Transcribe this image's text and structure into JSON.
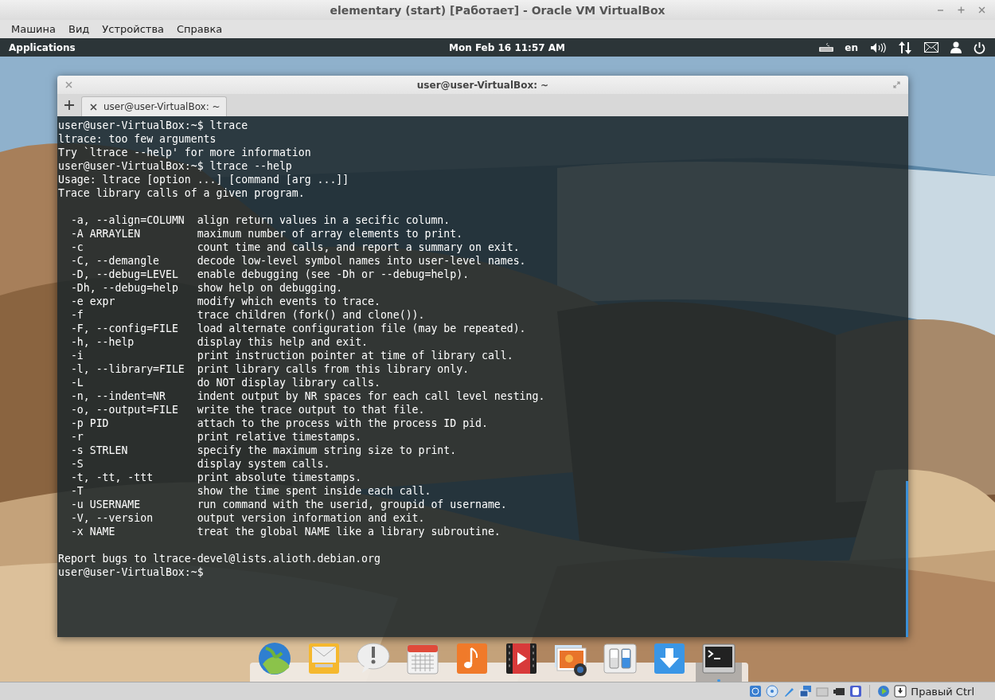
{
  "host_window": {
    "title": "elementary (start) [Работает] - Oracle VM VirtualBox",
    "menu": [
      "Машина",
      "Вид",
      "Устройства",
      "Справка"
    ]
  },
  "panel": {
    "applications": "Applications",
    "clock": "Mon Feb 16 11:57 AM",
    "language": "en"
  },
  "terminal": {
    "title": "user@user-VirtualBox: ~",
    "tabs": [
      {
        "label": "user@user-VirtualBox: ~",
        "selected": true
      }
    ],
    "blocks": [
      [
        "user@user-VirtualBox:~$ ltrace",
        "ltrace: too few arguments",
        "Try `ltrace --help' for more information",
        "user@user-VirtualBox:~$ ltrace --help",
        "Usage: ltrace [option ...] [command [arg ...]]",
        "Trace library calls of a given program."
      ],
      [
        "  -a, --align=COLUMN  align return values in a secific column.",
        "  -A ARRAYLEN         maximum number of array elements to print.",
        "  -c                  count time and calls, and report a summary on exit.",
        "  -C, --demangle      decode low-level symbol names into user-level names.",
        "  -D, --debug=LEVEL   enable debugging (see -Dh or --debug=help).",
        "  -Dh, --debug=help   show help on debugging.",
        "  -e expr             modify which events to trace.",
        "  -f                  trace children (fork() and clone()).",
        "  -F, --config=FILE   load alternate configuration file (may be repeated).",
        "  -h, --help          display this help and exit.",
        "  -i                  print instruction pointer at time of library call.",
        "  -l, --library=FILE  print library calls from this library only.",
        "  -L                  do NOT display library calls.",
        "  -n, --indent=NR     indent output by NR spaces for each call level nesting.",
        "  -o, --output=FILE   write the trace output to that file.",
        "  -p PID              attach to the process with the process ID pid.",
        "  -r                  print relative timestamps.",
        "  -s STRLEN           specify the maximum string size to print.",
        "  -S                  display system calls.",
        "  -t, -tt, -ttt       print absolute timestamps.",
        "  -T                  show the time spent inside each call.",
        "  -u USERNAME         run command with the userid, groupid of username.",
        "  -V, --version       output version information and exit.",
        "  -x NAME             treat the global NAME like a library subroutine."
      ],
      [
        "Report bugs to ltrace-devel@lists.alioth.debian.org",
        "user@user-VirtualBox:~$"
      ]
    ]
  },
  "dock": [
    {
      "kind": "globe",
      "active": false
    },
    {
      "kind": "mail",
      "active": false
    },
    {
      "kind": "notice",
      "active": false
    },
    {
      "kind": "calendar",
      "active": false
    },
    {
      "kind": "music",
      "active": false
    },
    {
      "kind": "video",
      "active": false
    },
    {
      "kind": "photos",
      "active": false
    },
    {
      "kind": "switches",
      "active": false
    },
    {
      "kind": "download",
      "active": false
    },
    {
      "kind": "terminal",
      "active": true
    }
  ],
  "status_bar": {
    "host_key": "Правый Ctrl"
  }
}
